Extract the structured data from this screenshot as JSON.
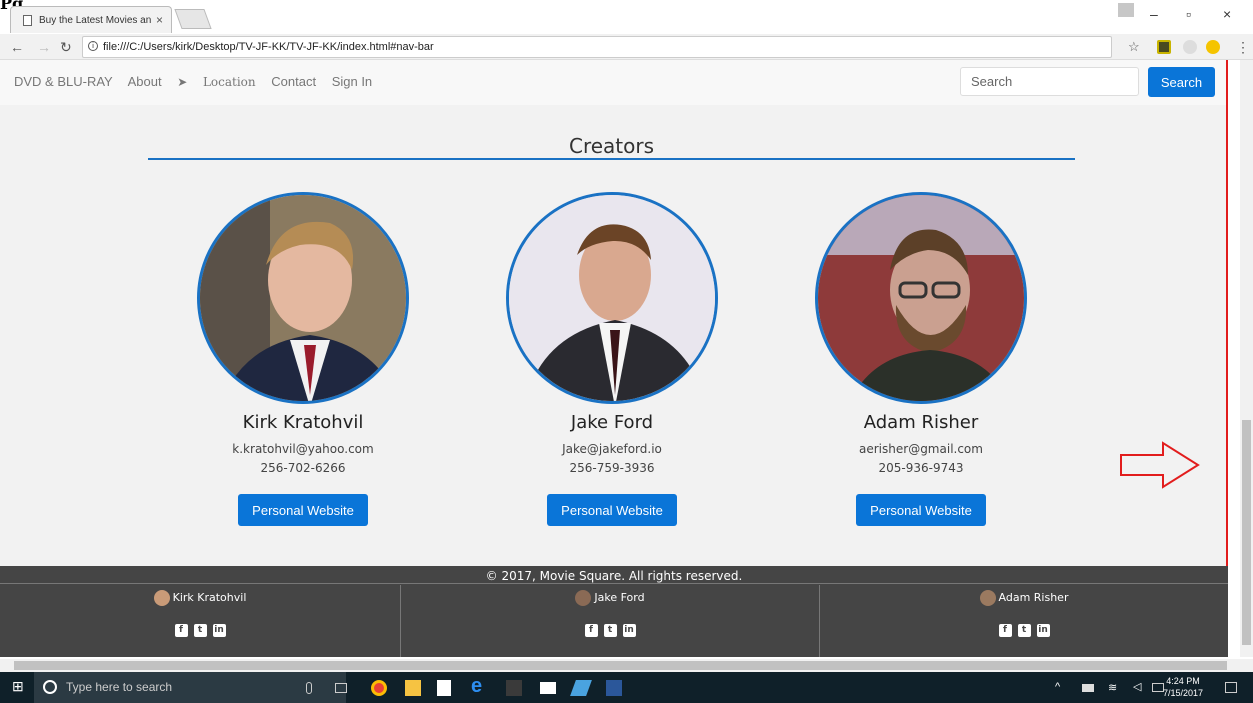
{
  "browser": {
    "tab_title": "Buy the Latest Movies an",
    "url": "file:///C:/Users/kirk/Desktop/TV-JF-KK/TV-JF-KK/index.html#nav-bar"
  },
  "nav": {
    "links": [
      "DVD & BLU-RAY",
      "About",
      "Location",
      "Contact",
      "Sign In"
    ],
    "search_placeholder": "Search",
    "search_button": "Search"
  },
  "section_title": "Creators",
  "creators": [
    {
      "name": "Kirk Kratohvil",
      "email": "k.kratohvil@yahoo.com",
      "phone": "256-702-6266",
      "button": "Personal Website"
    },
    {
      "name": "Jake Ford",
      "email": "Jake@jakeford.io",
      "phone": "256-759-3936",
      "button": "Personal Website"
    },
    {
      "name": "Adam Risher",
      "email": "aerisher@gmail.com",
      "phone": "205-936-9743",
      "button": "Personal Website"
    }
  ],
  "footer": {
    "copyright": "© 2017, Movie Square. All rights reserved.",
    "columns": [
      {
        "name": "Kirk Kratohvil",
        "socials": [
          "facebook-icon",
          "twitter-icon",
          "linkedin-icon"
        ]
      },
      {
        "name": "Jake Ford",
        "socials": [
          "facebook-icon",
          "twitter-icon",
          "linkedin-icon"
        ]
      },
      {
        "name": "Adam Risher",
        "socials": [
          "facebook-icon",
          "twitter-icon",
          "linkedin-icon"
        ]
      }
    ]
  },
  "taskbar": {
    "search_placeholder": "Type here to search",
    "time": "4:24 PM",
    "date": "7/15/2017"
  },
  "colors": {
    "accent": "#0a75d8",
    "footer": "#454545",
    "annotation": "#e21d1d"
  }
}
